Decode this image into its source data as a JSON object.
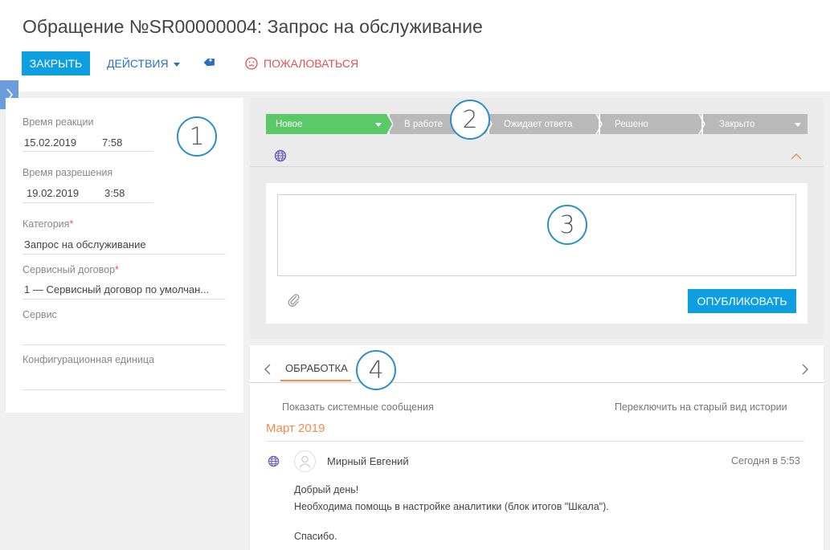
{
  "header": {
    "title": "Обращение №SR00000004: Запрос на обслуживание",
    "close_label": "ЗАКРЫТЬ",
    "actions_label": "ДЕЙСТВИЯ",
    "complain_label": "ПОЖАЛОВАТЬСЯ",
    "colors": {
      "primary": "#0d9fe0",
      "link": "#2a72bd",
      "danger": "#e35050"
    }
  },
  "left_panel": {
    "response_time": {
      "label": "Время реакции",
      "date": "15.02.2019",
      "time": "7:58"
    },
    "resolution_time": {
      "label": "Время разрешения",
      "date": "19.02.2019",
      "time": "3:58"
    },
    "category": {
      "label": "Категория",
      "required_mark": "*",
      "value": "Запрос на обслуживание"
    },
    "service_contract": {
      "label": "Сервисный договор",
      "required_mark": "*",
      "value": "1 — Сервисный договор по умолчан..."
    },
    "service": {
      "label": "Сервис",
      "value": ""
    },
    "config_item": {
      "label": "Конфигурационная единица",
      "value": ""
    }
  },
  "stages": [
    {
      "label": "Новое",
      "active": true
    },
    {
      "label": "В работе",
      "active": false
    },
    {
      "label": "Ожидает ответа",
      "active": false
    },
    {
      "label": "Решено",
      "active": false
    },
    {
      "label": "Закрыто",
      "active": false
    }
  ],
  "stage_colors": {
    "active": "#5bc86a",
    "inactive": "#b9b9b9"
  },
  "editor": {
    "publish_label": "ОПУБЛИКОВАТЬ",
    "value": ""
  },
  "history": {
    "tab_label": "ОБРАБОТКА",
    "show_system_label": "Показать системные сообщения",
    "switch_view_label": "Переключить на старый вид истории",
    "month": "Март 2019",
    "post": {
      "author": "Мирный Евгений",
      "time": "Сегодня в 5:53",
      "lines": [
        "Добрый день!",
        "Необходима помощь в настройке аналитики (блок итогов \"Шкала\").",
        "",
        "Спасибо."
      ]
    }
  },
  "annotations": [
    "1",
    "2",
    "3",
    "4"
  ],
  "icons": [
    "tag-icon",
    "sad-face-icon",
    "globe-icon",
    "chevron-up-icon",
    "paperclip-icon",
    "chevron-left-icon",
    "chevron-right-icon",
    "user-avatar-icon",
    "sidebar-expand-icon"
  ]
}
